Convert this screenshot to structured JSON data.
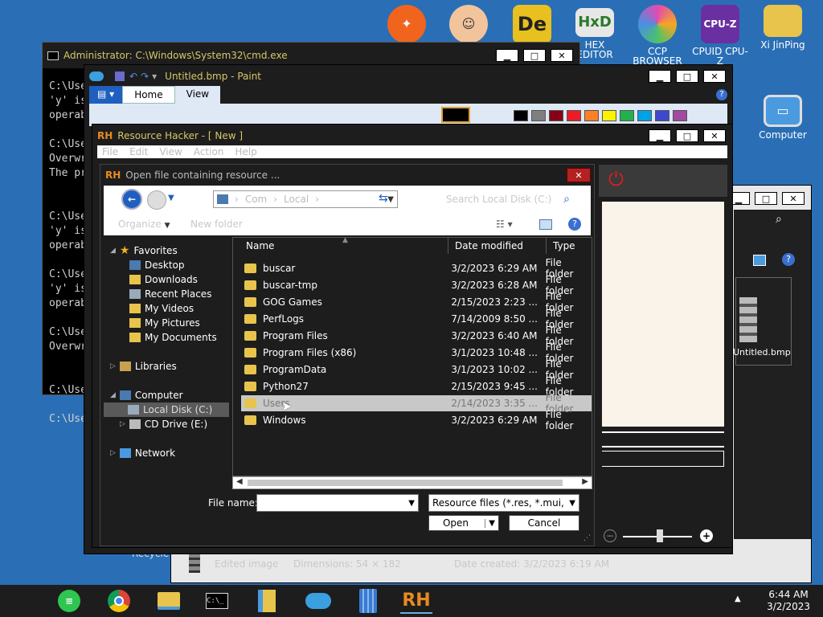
{
  "desktop_icons": [
    {
      "label": "",
      "color": "#f0641e",
      "glyph": "avast"
    },
    {
      "label": "",
      "color": "#f6b98a",
      "glyph": "doctor"
    },
    {
      "label": "",
      "color": "#e8c020",
      "glyph": "De"
    },
    {
      "label": "HEX EDITOR",
      "color": "#e7e7e7",
      "glyph": "HxD"
    },
    {
      "label": "CCP BROWSER",
      "color": "#e24ab2",
      "glyph": "ccp"
    },
    {
      "label": "CPUID CPU-Z",
      "color": "#6a2fa0",
      "glyph": "CPU-Z"
    },
    {
      "label": "Xi JinPing",
      "color": "#e8c44c",
      "glyph": "folder"
    },
    {
      "label": "Computer",
      "color": "#4a9ae0",
      "glyph": "computer"
    }
  ],
  "cmd": {
    "title": "Administrator: C:\\Windows\\System32\\cmd.exe",
    "lines": [
      "C:\\Use",
      "'y' is",
      "operab",
      "",
      "C:\\Use",
      "Overwr",
      "The pr",
      "",
      "",
      "C:\\Use",
      "'y' is",
      "operab",
      "",
      "C:\\Use",
      "'y' is",
      "operab",
      "",
      "C:\\Use",
      "Overwr",
      "",
      "",
      "C:\\Use",
      "",
      "C:\\Use"
    ]
  },
  "paint": {
    "title": "Untitled.bmp - Paint",
    "tabs": [
      "Home",
      "View"
    ],
    "palette": [
      "#000000",
      "#7f7f7f",
      "#880015",
      "#ed1c24",
      "#ff7f27",
      "#fff200",
      "#22b14c",
      "#00a2e8",
      "#3f48cc",
      "#a349a4"
    ]
  },
  "explorer": {
    "file_label": "Untitled.bmp",
    "status_name": "Edited image",
    "status_dimensions": "Dimensions: 54 × 182",
    "status_date": "Date created: 3/2/2023 6:19 AM"
  },
  "rh": {
    "title": "Resource Hacker - [ New ]",
    "menu": [
      "File",
      "Edit",
      "View",
      "Action",
      "Help"
    ]
  },
  "dialog": {
    "title": "Open file containing resource ...",
    "breadcrumb": [
      "Com",
      "Local"
    ],
    "search_placeholder": "Search Local Disk (C:)",
    "organize": "Organize",
    "new_folder": "New folder",
    "nav": {
      "favorites": "Favorites",
      "favorites_items": [
        "Desktop",
        "Downloads",
        "Recent Places",
        "My Videos",
        "My Pictures",
        "My Documents"
      ],
      "libraries": "Libraries",
      "computer": "Computer",
      "computer_items": [
        "Local Disk (C:)",
        "CD Drive (E:)"
      ],
      "network": "Network"
    },
    "columns": {
      "name": "Name",
      "date": "Date modified",
      "type": "Type"
    },
    "files": [
      {
        "name": "buscar",
        "date": "3/2/2023 6:29 AM",
        "type": "File folder"
      },
      {
        "name": "buscar-tmp",
        "date": "3/2/2023 6:28 AM",
        "type": "File folder"
      },
      {
        "name": "GOG Games",
        "date": "2/15/2023 2:23 ...",
        "type": "File folder"
      },
      {
        "name": "PerfLogs",
        "date": "7/14/2009 8:50 ...",
        "type": "File folder"
      },
      {
        "name": "Program Files",
        "date": "3/2/2023 6:40 AM",
        "type": "File folder"
      },
      {
        "name": "Program Files (x86)",
        "date": "3/1/2023 10:48 ...",
        "type": "File folder"
      },
      {
        "name": "ProgramData",
        "date": "3/1/2023 10:02 ...",
        "type": "File folder"
      },
      {
        "name": "Python27",
        "date": "2/15/2023 9:45 ...",
        "type": "File folder"
      },
      {
        "name": "Users",
        "date": "2/14/2023 3:35 ...",
        "type": "File folder"
      },
      {
        "name": "Windows",
        "date": "3/2/2023 6:29 AM",
        "type": "File folder"
      }
    ],
    "file_name_label": "File name:",
    "file_name_value": "",
    "filter": "Resource files (*.res, *.mui, *.",
    "open": "Open",
    "cancel": "Cancel"
  },
  "taskbar": {
    "time": "6:44 AM",
    "date": "3/2/2023"
  },
  "partial_desktop_label": "Recycle"
}
